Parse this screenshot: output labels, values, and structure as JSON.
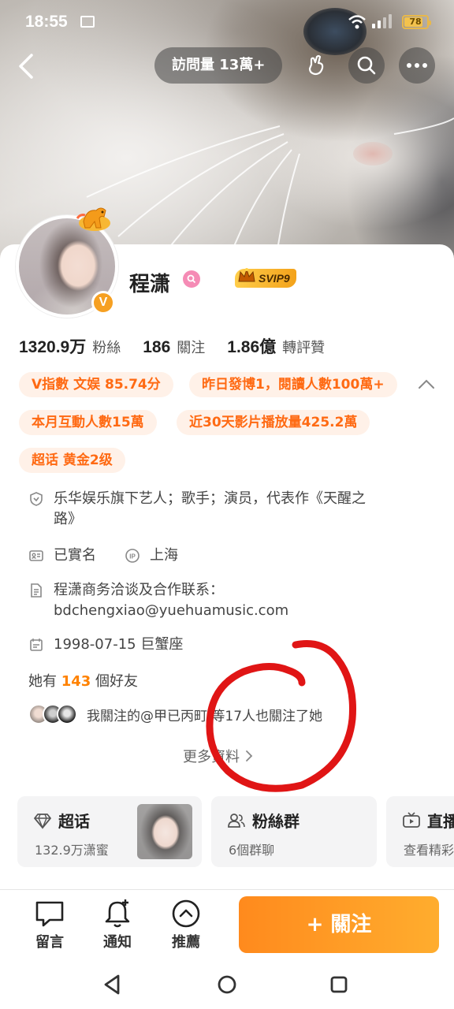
{
  "status_bar": {
    "time": "18:55",
    "battery": "78",
    "battery_level": 0.78
  },
  "top_nav": {
    "visits": "訪問量 13萬+"
  },
  "profile": {
    "name": "程潇",
    "svip": "SVIP9",
    "v_badge": "V"
  },
  "stats": [
    {
      "value": "1320.9万",
      "label": "粉絲"
    },
    {
      "value": "186",
      "label": "關注"
    },
    {
      "value": "1.86億",
      "label": "轉評贊"
    }
  ],
  "tags": [
    "V指數 文娱 85.74分",
    "昨日發博1，閱讀人數100萬+",
    "本月互動人數15萬",
    "近30天影片播放量425.2萬",
    "超话 黄金2级"
  ],
  "info": {
    "bio_line1": "乐华娱乐旗下艺人；歌手；演员，代表作《天醒之",
    "bio_line2": "路》",
    "verified": "已實名",
    "ip": "上海",
    "contact_line1": "程潇商务洽谈及合作联系：",
    "contact_line2": "bdchengxiao@yuehuamusic.com",
    "birthday": "1998-07-15 巨蟹座"
  },
  "friends": {
    "prefix": "她有 ",
    "count": "143",
    "suffix": " 個好友",
    "mutual": "我關注的@甲已丙町 等17人也關注了她"
  },
  "more_info": "更多資料",
  "tiles": [
    {
      "title": "超话",
      "sub": "132.9万潇蜜"
    },
    {
      "title": "粉絲群",
      "sub": "6個群聊"
    },
    {
      "title": "直播",
      "sub": "查看精彩"
    }
  ],
  "bottom_bar": {
    "comment": "留言",
    "notify": "通知",
    "recommend": "推薦",
    "follow": "+ 關注"
  },
  "colors": {
    "accent": "#ff8200",
    "tag_text": "#ff6a13",
    "tag_bg": "#fff1e8",
    "annotation_red": "#e01515"
  }
}
